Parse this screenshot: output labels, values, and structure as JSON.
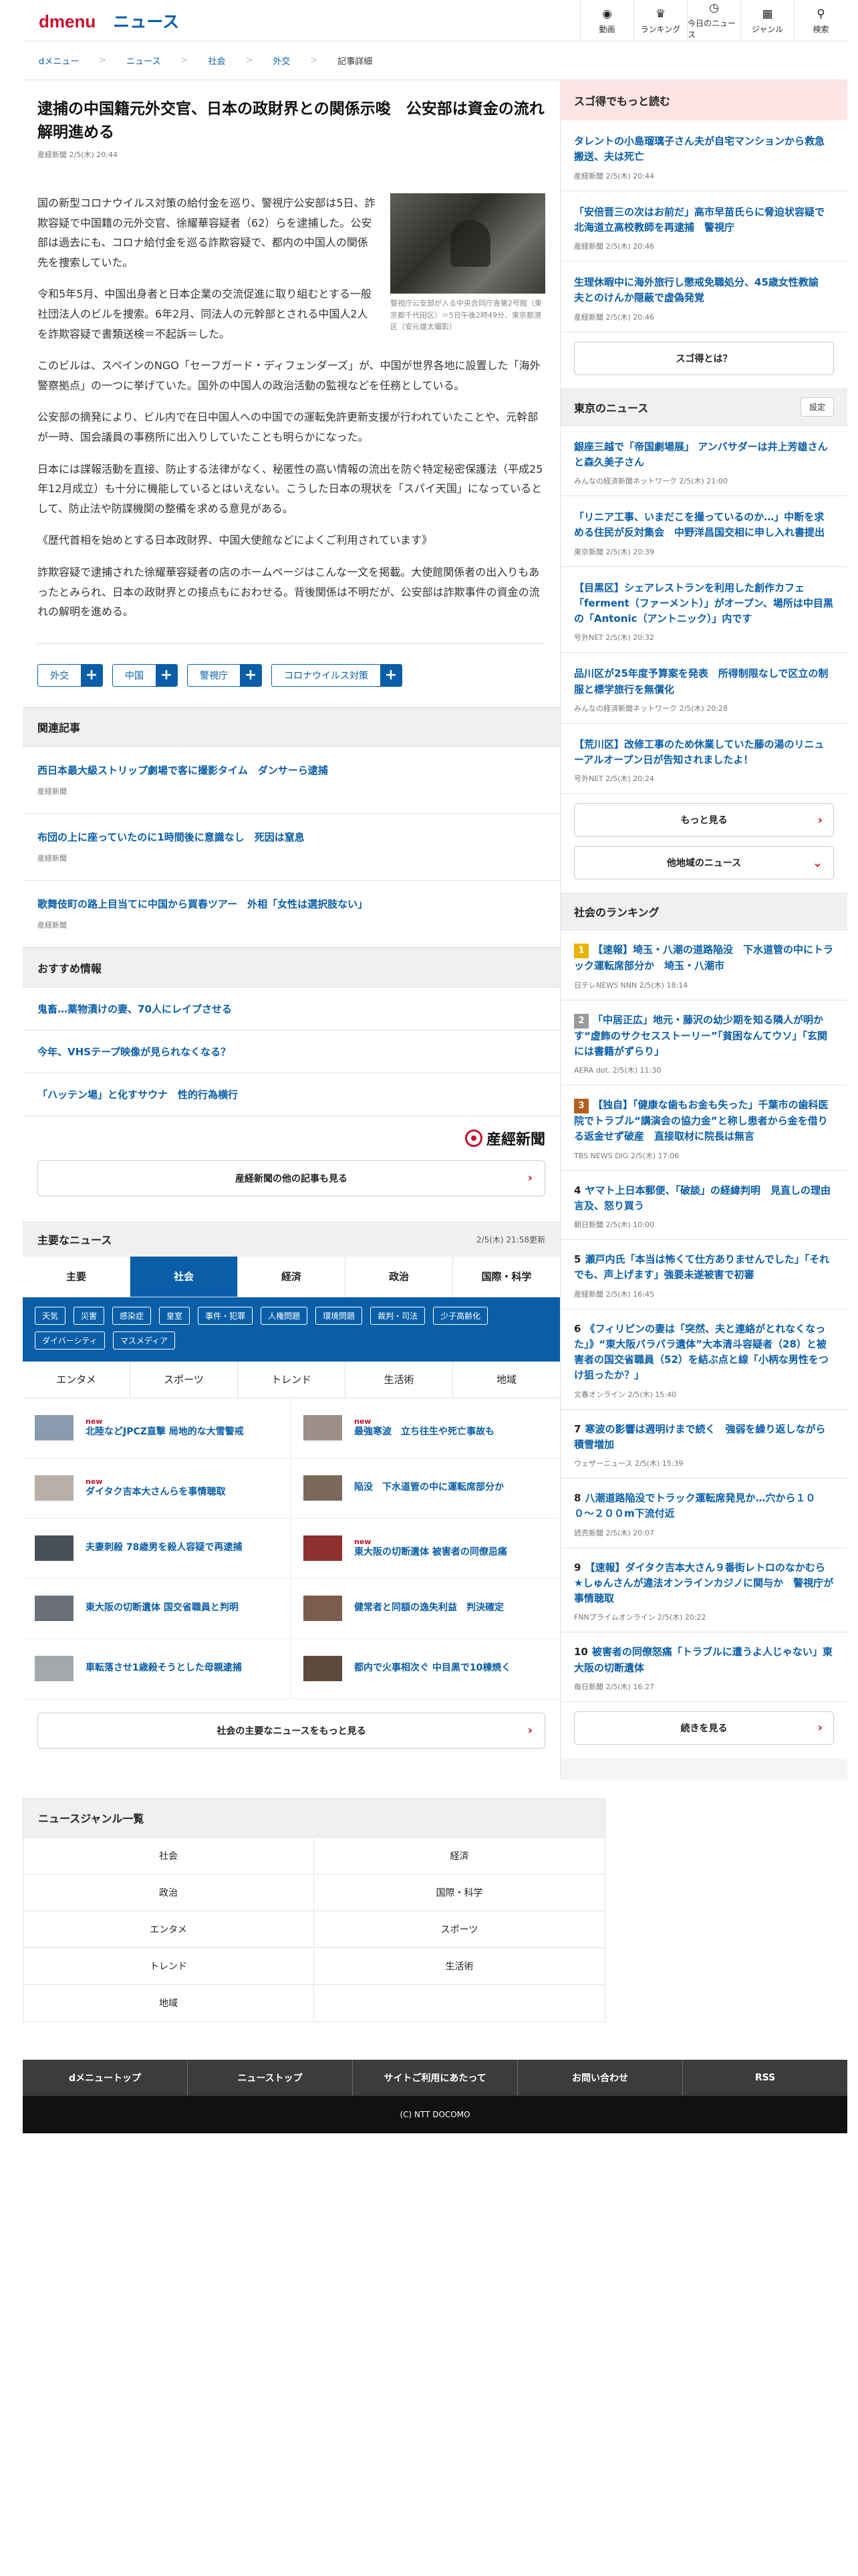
{
  "header": {
    "logo_d": "dmenu",
    "logo_news": "ニュース",
    "nav": [
      {
        "label": "動画",
        "icon": "video-icon"
      },
      {
        "label": "ランキング",
        "icon": "trophy-icon"
      },
      {
        "label": "今日のニュース",
        "icon": "clock-icon"
      },
      {
        "label": "ジャンル",
        "icon": "grid-icon"
      },
      {
        "label": "検索",
        "icon": "search-icon"
      }
    ]
  },
  "breadcrumb": [
    "dメニュー",
    "ニュース",
    "社会",
    "外交",
    "記事詳細"
  ],
  "article": {
    "title": "逮捕の中国籍元外交官、日本の政財界との関係示唆　公安部は資金の流れ解明進める",
    "meta": "産経新聞 2/5(木) 20:44",
    "caption": "警視庁公安部が入る中央合同庁舎第2号館（東京都千代田区）＝5日午後2時49分、東京都港区（安元雄太撮影）",
    "paragraphs": [
      "国の新型コロナウイルス対策の給付金を巡り、警視庁公安部は5日、詐欺容疑で中国籍の元外交官、徐耀華容疑者（62）らを逮捕した。公安部は過去にも、コロナ給付金を巡る詐欺容疑で、都内の中国人の関係先を捜索していた。",
      "令和5年5月、中国出身者と日本企業の交流促進に取り組むとする一般社団法人のビルを捜索。6年2月、同法人の元幹部とされる中国人2人を詐欺容疑で書類送検＝不起訴＝した。",
      "このビルは、スペインのNGO「セーフガード・ディフェンダーズ」が、中国が世界各地に設置した「海外警察拠点」の一つに挙げていた。国外の中国人の政治活動の監視などを任務としている。",
      "公安部の摘発により、ビル内で在日中国人への中国での運転免許更新支援が行われていたことや、元幹部が一時、国会議員の事務所に出入りしていたことも明らかになった。",
      "日本には諜報活動を直接、防止する法律がなく、秘匿性の高い情報の流出を防ぐ特定秘密保護法（平成25年12月成立）も十分に機能しているとはいえない。こうした日本の現状を「スパイ天国」になっているとして、防止法や防諜機関の整備を求める意見がある。",
      "《歴代首相を始めとする日本政財界、中国大使館などによくご利用されています》",
      "詐欺容疑で逮捕された徐耀華容疑者の店のホームページはこんな一文を掲載。大使館関係者の出入りもあったとみられ、日本の政財界との接点もにおわせる。背後関係は不明だが、公安部は詐欺事件の資金の流れの解明を進める。"
    ],
    "tags": [
      "外交",
      "中国",
      "警視庁",
      "コロナウイルス対策"
    ]
  },
  "related": {
    "heading": "関連記事",
    "items": [
      {
        "title": "西日本最大級ストリップ劇場で客に撮影タイム　ダンサーら逮捕",
        "source": "産経新聞"
      },
      {
        "title": "布団の上に座っていたのに1時間後に意識なし　死因は窒息",
        "source": "産経新聞"
      },
      {
        "title": "歌舞伎町の路上目当てに中国から買春ツアー　外相「女性は選択肢ない」",
        "source": "産経新聞"
      }
    ]
  },
  "recommend": {
    "heading": "おすすめ情報",
    "items": [
      "鬼畜…薬物漬けの妻、70人にレイプさせる",
      "今年、VHSテープ映像が見られなくなる？",
      "「ハッテン場」と化すサウナ　性的行為横行"
    ],
    "sankei_logo": "産經新聞",
    "more_button": "産経新聞の他の記事も見る"
  },
  "major": {
    "heading": "主要なニュース",
    "updated": "2/5(木) 21:58更新",
    "tabs": [
      "主要",
      "社会",
      "経済",
      "政治",
      "国際・科学"
    ],
    "active_tab": 1,
    "subtags": [
      "天気",
      "災害",
      "感染症",
      "皇室",
      "事件・犯罪",
      "人権問題",
      "環境問題",
      "裁判・司法",
      "少子高齢化",
      "ダイバーシティ",
      "マスメディア"
    ],
    "tabs2": [
      "エンタメ",
      "スポーツ",
      "トレンド",
      "生活術",
      "地域"
    ],
    "items": [
      {
        "title": "北陸などJPCZ直撃 局地的な大雪警戒",
        "new": "new",
        "thumb": "#8a9bb0"
      },
      {
        "title": "最強寒波　立ち往生や死亡事故も",
        "new": "new",
        "thumb": "#9b8f88"
      },
      {
        "title": "ダイタク吉本大さんらを事情聴取",
        "new": "new",
        "thumb": "#b8b0a6"
      },
      {
        "title": "陥没　下水道管の中に運転席部分か",
        "new": "",
        "thumb": "#7b6a5a"
      },
      {
        "title": "夫妻刺殺 78歳男を殺人容疑で再逮捕",
        "new": "",
        "thumb": "#4a5058"
      },
      {
        "title": "東大阪の切断遺体 被害者の同僚忌痛",
        "new": "new",
        "thumb": "#8f2f2f"
      },
      {
        "title": "東大阪の切断遺体 国交省職員と判明",
        "new": "",
        "thumb": "#6b7078"
      },
      {
        "title": "健常者と同額の逸失利益　判決確定",
        "new": "",
        "thumb": "#7c5d4d"
      },
      {
        "title": "車転落させ1歳殺そうとした母親逮捕",
        "new": "",
        "thumb": "#a3a8ac"
      },
      {
        "title": "都内で火事相次ぐ 中目黒で10棟焼く",
        "new": "",
        "thumb": "#5d4a3c"
      }
    ],
    "more_button": "社会の主要なニュースをもっと見る"
  },
  "sidebar": {
    "sugo": {
      "heading": "スゴ得でもっと読む",
      "items": [
        {
          "title": "タレントの小島瑠璃子さん夫が自宅マンションから救急搬送、夫は死亡",
          "source": "産経新聞 2/5(木) 20:44"
        },
        {
          "title": "「安倍晋三の次はお前だ」高市早苗氏らに脅迫状容疑で北海道立高校教師を再逮捕　警視庁",
          "source": "産経新聞 2/5(木) 20:46"
        },
        {
          "title": "生理休暇中に海外旅行し懲戒免職処分、45歳女性教諭　夫とのけんか隠蔽で虚偽発覚",
          "source": "産経新聞 2/5(木) 20:46"
        }
      ],
      "button": "スゴ得とは？"
    },
    "tokyo": {
      "heading": "東京のニュース",
      "settings": "設定",
      "items": [
        {
          "title": "銀座三越で「帝国劇場展」 アンバサダーは井上芳雄さんと森久美子さん",
          "source": "みんなの経済新聞ネットワーク 2/5(木) 21:00"
        },
        {
          "title": "「リニア工事、いまだこを撮っているのか…」中断を求める住民が反対集会　中野洋昌国交相に申し入れ書提出",
          "source": "東京新聞 2/5(木) 20:39"
        },
        {
          "title": "【目黒区】シェアレストランを利用した創作カフェ「ferment（ファーメント）」がオープン、場所は中目黒の「Antonic（アントニック）」内です",
          "source": "号外NET 2/5(木) 20:32"
        },
        {
          "title": "品川区が25年度予算案を発表　所得制限なしで区立の制服と標学旅行を無償化",
          "source": "みんなの経済新聞ネットワーク 2/5(木) 20:28"
        },
        {
          "title": "【荒川区】改修工事のため休業していた藤の湯のリニューアルオープン日が告知されましたよ！",
          "source": "号外NET 2/5(木) 20:24"
        }
      ],
      "more_button": "もっと見る",
      "other_button": "他地域のニュース"
    },
    "ranking": {
      "heading": "社会のランキング",
      "items": [
        {
          "num": "1",
          "title": "【速報】埼玉・八潮の道路陥没　下水道管の中にトラック運転席部分か　埼玉・八潮市",
          "source": "日テレNEWS NNN 2/5(木) 18:14"
        },
        {
          "num": "2",
          "title": "「中居正広」地元・藤沢の幼少期を知る隣人が明かす“虚飾のサクセスストーリー”「貧困なんてウソ」「玄関には書籍がずらり」",
          "source": "AERA dot. 2/5(木) 11:30"
        },
        {
          "num": "3",
          "title": "【独自】「健康な歯もお金も失った」千葉市の歯科医院でトラブル“講演会の協力金”と称し患者から金を借りる返金せず破産　直接取材に院長は無言",
          "source": "TBS NEWS DIG 2/5(木) 17:06"
        },
        {
          "num": "4",
          "title": "ヤマト上日本郵便、「破談」の経緯判明　見直しの理由言及、怒り買う",
          "source": "朝日新聞 2/5(木) 10:00"
        },
        {
          "num": "5",
          "title": "瀬戸内氏「本当は怖くて仕方ありませんでした」「それでも、声上げます」強要未遂被害で初審",
          "source": "産経新聞 2/5(木) 16:45"
        },
        {
          "num": "6",
          "title": "《フィリピンの妻は「突然、夫と連絡がとれなくなった」》“東大阪バラバラ遺体”大本清斗容疑者（28）と被害者の国交省職員（52）を結ぶ点と線「小柄な男性をつけ狙ったか？」",
          "source": "文春オンライン 2/5(木) 15:40"
        },
        {
          "num": "7",
          "title": "寒波の影響は週明けまで続く　強弱を繰り返しながら積雪増加",
          "source": "ウェザーニュース 2/5(木) 15:39"
        },
        {
          "num": "8",
          "title": "八潮道路陥没でトラック運転席発見か…穴から１００〜２００m下流付近",
          "source": "読売新聞 2/5(木) 20:07"
        },
        {
          "num": "9",
          "title": "【速報】ダイタク吉本大さん９番街レトロのなかむら★しゅんさんが違法オンラインカジノに関与か　警視庁が事情聴取",
          "source": "FNNプライムオンライン 2/5(木) 20:22"
        },
        {
          "num": "10",
          "title": "被害者の同僚怒痛「トラブルに遭うよ人じゃない」東大阪の切断遺体",
          "source": "毎日新聞 2/5(木) 16:27"
        }
      ],
      "more_button": "続きを見る"
    }
  },
  "genre": {
    "heading": "ニュースジャンル一覧",
    "items": [
      "社会",
      "経済",
      "政治",
      "国際・科学",
      "エンタメ",
      "スポーツ",
      "トレンド",
      "生活術",
      "地域"
    ]
  },
  "footer": {
    "nav": [
      "dメニュートップ",
      "ニューストップ",
      "サイトご利用にあたって",
      "お問い合わせ",
      "RSS"
    ],
    "copyright": "(C) NTT DOCOMO"
  },
  "colors": {
    "accent": "#0a5ea8",
    "brand_red": "#c8102e",
    "footer": "#3c3c3c"
  }
}
